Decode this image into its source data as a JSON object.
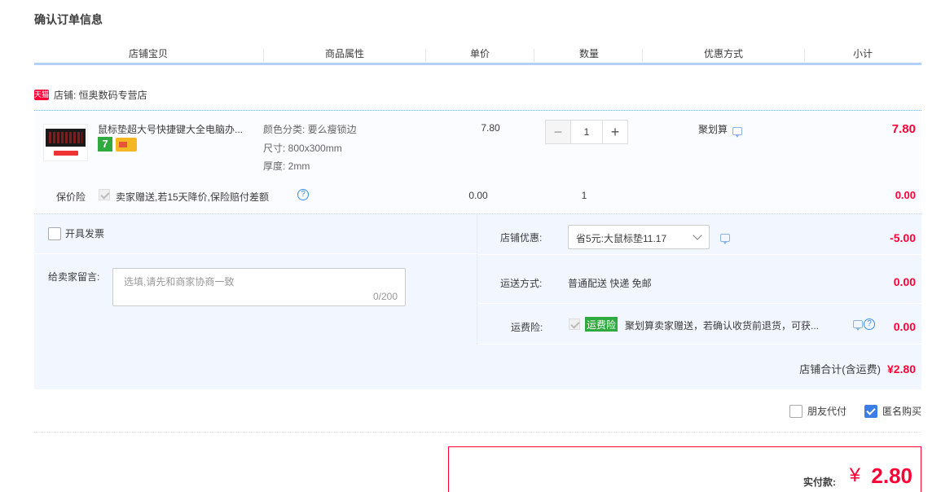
{
  "page": {
    "title": "确认订单信息"
  },
  "columns": [
    "店铺宝贝",
    "商品属性",
    "单价",
    "数量",
    "优惠方式",
    "小计"
  ],
  "shop": {
    "badge": "天猫",
    "label": "店铺: 恒奥数码专营店"
  },
  "item": {
    "title": "鼠标垫超大号快捷键大全电脑办...",
    "badge_seven": "7",
    "attrs": [
      "颜色分类: 要么瘦锁边",
      "尺寸: 800x300mm",
      "厚度: 2mm"
    ],
    "unit_price": "7.80",
    "quantity": "1",
    "qty_minus": "−",
    "qty_plus": "+",
    "promo": "聚划算",
    "subtotal": "7.80"
  },
  "insurance": {
    "label": "保价险",
    "desc": "卖家赠送,若15天降价,保险赔付差额",
    "help": "?",
    "price": "0.00",
    "qty": "1",
    "total": "0.00"
  },
  "invoice": {
    "label": "开具发票"
  },
  "memo": {
    "label": "给卖家留言:",
    "placeholder": "选填,请先和商家协商一致",
    "counter": "0/200"
  },
  "store_discount": {
    "label": "店铺优惠:",
    "selected": "省5元:大鼠标垫11.17",
    "amount": "-5.00"
  },
  "shipping": {
    "label": "运送方式:",
    "value": "普通配送 快递 免邮",
    "amount": "0.00"
  },
  "freight_insurance": {
    "label": "运费险:",
    "badge": "运费险",
    "desc": "聚划算卖家赠送，若确认收货前退货，可获...",
    "help": "?",
    "amount": "0.00"
  },
  "store_total": {
    "label": "店铺合计(含运费)",
    "amount": "¥2.80"
  },
  "options": {
    "friend_pay": "朋友代付",
    "anonymous": "匿名购买",
    "anonymous_checked": true
  },
  "payment": {
    "label": "实付款:",
    "currency": "¥",
    "amount": "2.80"
  },
  "colors": {
    "accent_red": "#ff0036",
    "header_line": "#b2d1ff",
    "link_blue": "#3a8ee6",
    "badge_green": "#2eaa3f"
  }
}
